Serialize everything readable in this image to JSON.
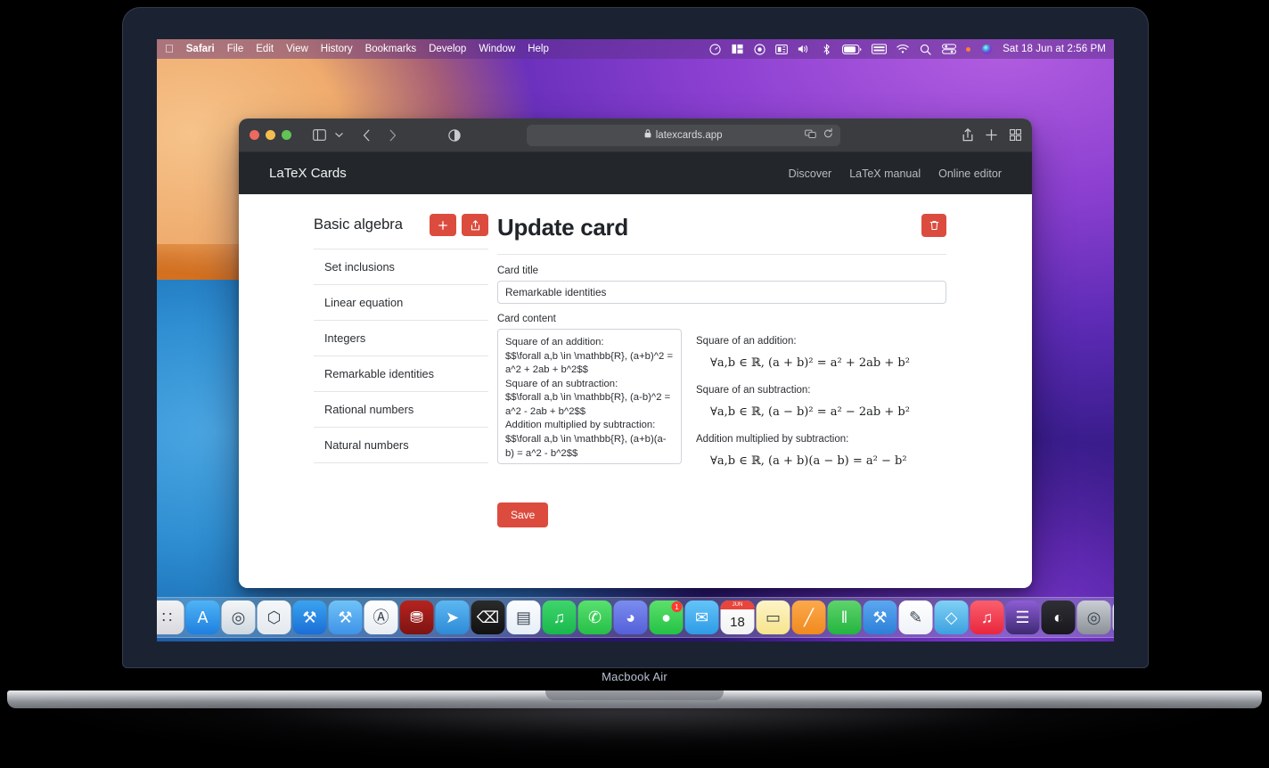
{
  "device": {
    "caption": "Macbook Air"
  },
  "menubar": {
    "apple_icon": "apple-icon",
    "items": [
      {
        "label": "Safari",
        "bold": true
      },
      {
        "label": "File",
        "bold": false
      },
      {
        "label": "Edit",
        "bold": false
      },
      {
        "label": "View",
        "bold": false
      },
      {
        "label": "History",
        "bold": false
      },
      {
        "label": "Bookmarks",
        "bold": false
      },
      {
        "label": "Develop",
        "bold": false
      },
      {
        "label": "Window",
        "bold": false
      },
      {
        "label": "Help",
        "bold": false
      }
    ],
    "status_icons": [
      "speedometer-icon",
      "stage-manager-icon",
      "screen-record-icon",
      "display-icon",
      "volume-icon",
      "bluetooth-icon",
      "battery-icon",
      "keyboard-icon",
      "wifi-icon",
      "search-icon",
      "control-center-icon",
      "siri-icon"
    ],
    "clock": "Sat 18 Jun at  2:56 PM"
  },
  "browser": {
    "traffic_lights": [
      "close",
      "minimize",
      "zoom"
    ],
    "sidebar_icon": "sidebar-icon",
    "tab_overview_chevron": "chevron-down-icon",
    "back_icon": "chevron-left-icon",
    "forward_icon": "chevron-right-icon",
    "reader_icon": "reader-contrast-icon",
    "url": "latexcards.app",
    "lock_icon": "lock-icon",
    "extension_icon": "extension-icon",
    "reload_icon": "reload-icon",
    "share_icon": "share-icon",
    "new_tab_icon": "plus-icon",
    "tabs_icon": "tab-grid-icon"
  },
  "site": {
    "brand": "LaTeX Cards",
    "nav": [
      {
        "label": "Discover"
      },
      {
        "label": "LaTeX manual"
      },
      {
        "label": "Online editor"
      }
    ]
  },
  "deck": {
    "title": "Basic algebra",
    "add_label": "+",
    "add_icon": "plus-icon",
    "export_icon": "share-icon",
    "cards": [
      {
        "label": "Set inclusions"
      },
      {
        "label": "Linear equation"
      },
      {
        "label": "Integers"
      },
      {
        "label": "Remarkable identities"
      },
      {
        "label": "Rational numbers"
      },
      {
        "label": "Natural numbers"
      }
    ]
  },
  "form": {
    "heading": "Update card",
    "delete_icon": "trash-icon",
    "title_label": "Card title",
    "title_value": "Remarkable identities",
    "title_placeholder": "Card title",
    "content_label": "Card content",
    "content_value": "Square of an addition:\n$$\\forall a,b \\in \\mathbb{R}, (a+b)^2 = a^2 + 2ab + b^2$$\nSquare of an subtraction:\n$$\\forall a,b \\in \\mathbb{R}, (a-b)^2 = a^2 - 2ab + b^2$$\nAddition multiplied by subtraction:\n$$\\forall a,b \\in \\mathbb{R}, (a+b)(a-b) = a^2 - b^2$$",
    "content_placeholder": "Card content",
    "save_label": "Save"
  },
  "preview": {
    "blocks": [
      {
        "label": "Square of an addition:",
        "math_prefix": "∀a, b ∈ ℝ, (a + b)",
        "math": "∀a,b ∈ ℝ, (a + b)² = a² + 2ab + b²"
      },
      {
        "label": "Square of an subtraction:",
        "math": "∀a,b ∈ ℝ, (a − b)² = a² − 2ab + b²"
      },
      {
        "label": "Addition multiplied by subtraction:",
        "math": "∀a,b ∈ ℝ, (a + b)(a − b) = a² − b²"
      }
    ]
  },
  "dock": {
    "items": [
      {
        "name": "finder",
        "glyph": "◑",
        "bg": "linear-gradient(180deg,#4aa7e8,#2b7fd0)",
        "running": true
      },
      {
        "name": "siri",
        "glyph": "◉",
        "bg": "radial-gradient(circle at 40% 35%,#ff79d1,#7b2aa8 60%,#231033)",
        "running": false
      },
      {
        "name": "launchpad",
        "glyph": "∷",
        "bg": "linear-gradient(180deg,#f2f2f4,#d9d9dd)",
        "running": false
      },
      {
        "name": "app-store",
        "glyph": "A",
        "bg": "linear-gradient(180deg,#4eb4f5,#1f7fe0)",
        "running": false
      },
      {
        "name": "safari",
        "glyph": "◎",
        "bg": "linear-gradient(180deg,#f4f6f8,#cfd8e0)",
        "running": true
      },
      {
        "name": "vs-code",
        "glyph": "⬡",
        "bg": "linear-gradient(180deg,#f5f7f9,#e4e9ee)",
        "running": false
      },
      {
        "name": "xcode",
        "glyph": "⚒",
        "bg": "linear-gradient(180deg,#3aa3f0,#1b6ed6)",
        "running": true
      },
      {
        "name": "xcode-beta",
        "glyph": "⚒",
        "bg": "linear-gradient(180deg,#6fc3f7,#3f93e8)",
        "running": false
      },
      {
        "name": "android-studio",
        "glyph": "Ⓐ",
        "bg": "linear-gradient(180deg,#ffffff,#e8edf2)",
        "running": false
      },
      {
        "name": "database",
        "glyph": "⛃",
        "bg": "linear-gradient(180deg,#b6231f,#7d1412)",
        "running": false
      },
      {
        "name": "transmit",
        "glyph": "➤",
        "bg": "linear-gradient(180deg,#5cb8f2,#2e8ad6)",
        "running": false
      },
      {
        "name": "terminal",
        "glyph": "⌫",
        "bg": "linear-gradient(180deg,#2b2b2b,#111)",
        "running": false
      },
      {
        "name": "trello",
        "glyph": "▤",
        "bg": "linear-gradient(180deg,#fbfdff,#e6eef7)",
        "running": false
      },
      {
        "name": "spotify",
        "glyph": "♫",
        "bg": "linear-gradient(180deg,#3fd56b,#18b84d)",
        "running": true
      },
      {
        "name": "whatsapp",
        "glyph": "✆",
        "bg": "linear-gradient(180deg,#59e06f,#25bf46)",
        "running": false
      },
      {
        "name": "discord",
        "glyph": "◕",
        "bg": "linear-gradient(180deg,#7a8cf0,#5560d8)",
        "running": false
      },
      {
        "name": "messages",
        "glyph": "●",
        "bg": "linear-gradient(180deg,#5ce06b,#24c246)",
        "running": true,
        "badge": "1"
      },
      {
        "name": "mail",
        "glyph": "✉",
        "bg": "linear-gradient(180deg,#63c4f8,#2e9be6)",
        "running": false
      },
      {
        "name": "calendar",
        "glyph": "18",
        "bg": "linear-gradient(180deg,#ffffff,#f2f2f4)",
        "running": false,
        "calendar_month": "JUN",
        "calendar_day": "18"
      },
      {
        "name": "notes",
        "glyph": "▭",
        "bg": "linear-gradient(180deg,#fdf4c6,#f6e48c)",
        "running": false
      },
      {
        "name": "pages",
        "glyph": "╱",
        "bg": "linear-gradient(180deg,#fba94c,#f08a1e)",
        "running": false
      },
      {
        "name": "numbers",
        "glyph": "‖",
        "bg": "linear-gradient(180deg,#5fd36c,#23b53f)",
        "running": false
      },
      {
        "name": "keynote",
        "glyph": "⚒",
        "bg": "linear-gradient(180deg,#5ba7f0,#2d7fd8)",
        "running": false
      },
      {
        "name": "textedit",
        "glyph": "✎",
        "bg": "linear-gradient(180deg,#ffffff,#eef2f7)",
        "running": false
      },
      {
        "name": "sketch",
        "glyph": "◇",
        "bg": "linear-gradient(180deg,#7fd1f5,#3da0e0)",
        "running": false
      },
      {
        "name": "music",
        "glyph": "♫",
        "bg": "linear-gradient(180deg,#fb5f6d,#e8263d)",
        "running": false
      },
      {
        "name": "imovie",
        "glyph": "☰",
        "bg": "linear-gradient(180deg,#8d5cd6,#3d2a72)",
        "running": false
      },
      {
        "name": "figma",
        "glyph": "◐",
        "bg": "linear-gradient(180deg,#2f2f36,#17171c)",
        "running": true
      },
      {
        "name": "screen-app",
        "glyph": "◎",
        "bg": "linear-gradient(180deg,#c9ced3,#8b9197)",
        "running": false
      },
      {
        "name": "quicktime",
        "glyph": "▶",
        "bg": "linear-gradient(180deg,#eef1f4,#c3ccd4)",
        "running": true
      }
    ],
    "trash": {
      "name": "trash",
      "glyph": "🗑"
    }
  }
}
